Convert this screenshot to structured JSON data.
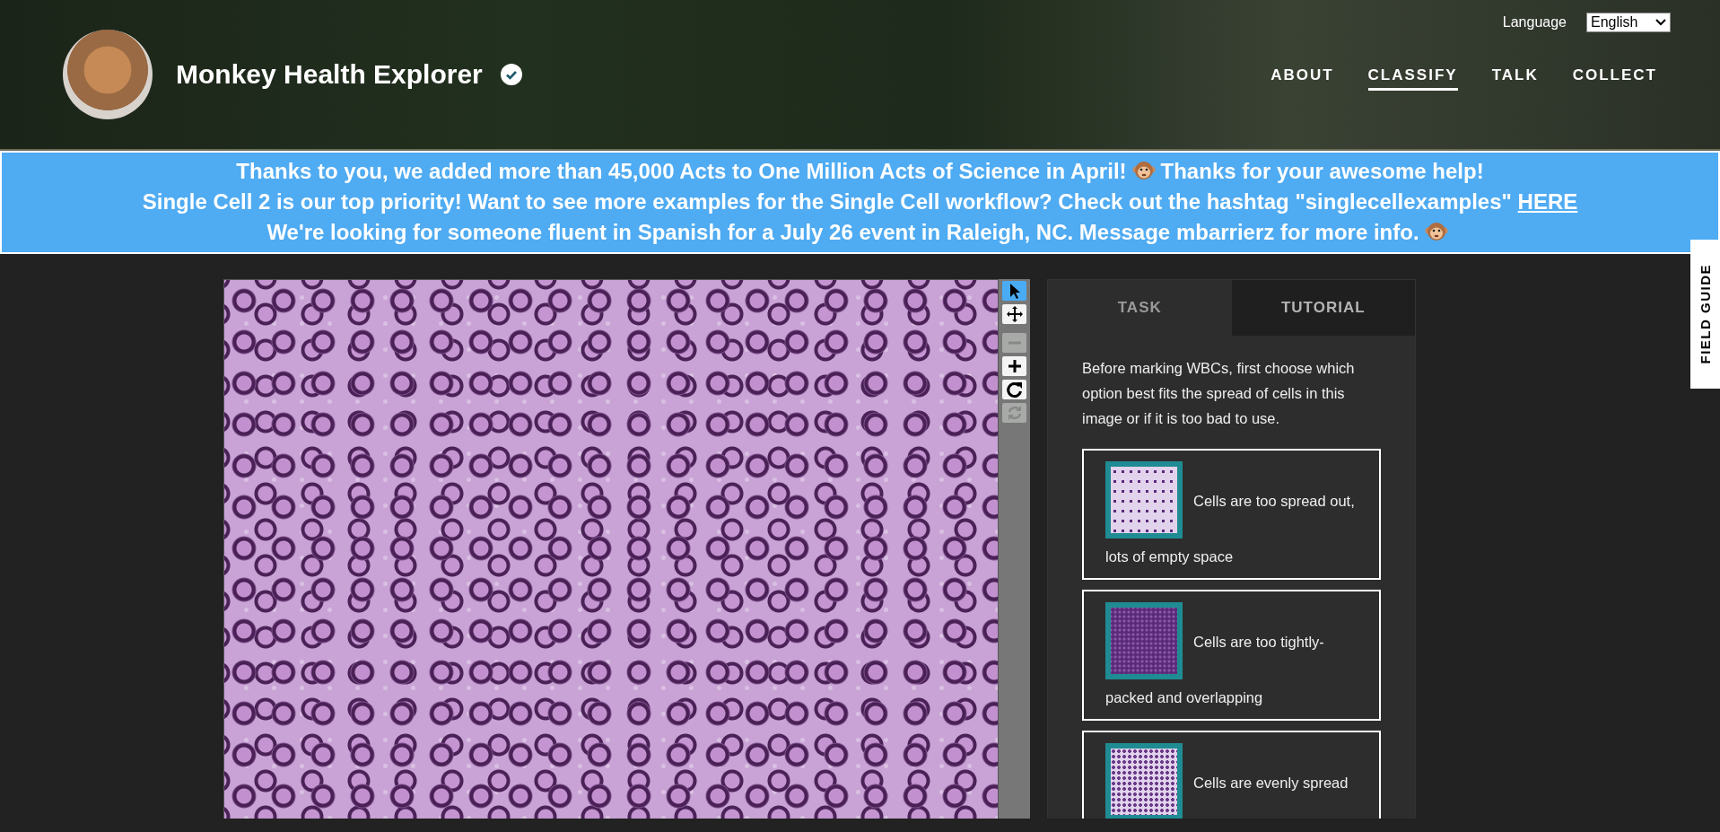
{
  "header": {
    "title": "Monkey Health Explorer",
    "verified": true,
    "language_label": "Language",
    "language_value": "English",
    "nav": [
      {
        "label": "ABOUT",
        "selected": false
      },
      {
        "label": "CLASSIFY",
        "selected": true
      },
      {
        "label": "TALK",
        "selected": false
      },
      {
        "label": "COLLECT",
        "selected": false
      }
    ]
  },
  "announcements": [
    {
      "text": "Thanks to you, we added more than 45,000 Acts to One Million Acts of Science in April!",
      "emoji": true,
      "after": "Thanks for your awesome help!"
    },
    {
      "text": "Single Cell 2 is our top priority! Want to see more examples for the Single Cell workflow? Check out the hashtag \"singlecellexamples\"",
      "link": "HERE"
    },
    {
      "text": "We're looking for someone fluent in Spanish for a July 26 event in Raleigh, NC. Message mbarrierz for more info.",
      "emoji": true
    }
  ],
  "tools": [
    {
      "kind": "pointer",
      "selected": true,
      "disabled": false
    },
    {
      "kind": "move",
      "selected": false,
      "disabled": false
    },
    {
      "kind": "zoom-out",
      "selected": false,
      "disabled": true
    },
    {
      "kind": "zoom-in",
      "selected": false,
      "disabled": false
    },
    {
      "kind": "rotate",
      "selected": false,
      "disabled": false
    },
    {
      "kind": "reset",
      "selected": false,
      "disabled": true
    }
  ],
  "tabs": [
    {
      "label": "TASK",
      "selected": true
    },
    {
      "label": "TUTORIAL",
      "selected": false
    }
  ],
  "instruction": "Before marking WBCs, first choose which option best fits the spread of cells in this image or if it is too bad to use.",
  "options": [
    {
      "label": "Cells are too spread out, lots of empty space",
      "kind": "sparse"
    },
    {
      "label": "Cells are too tightly-packed and overlapping",
      "kind": "dense"
    },
    {
      "label": "Cells are evenly spread",
      "kind": "even"
    }
  ],
  "field_guide": "FIELD GUIDE"
}
